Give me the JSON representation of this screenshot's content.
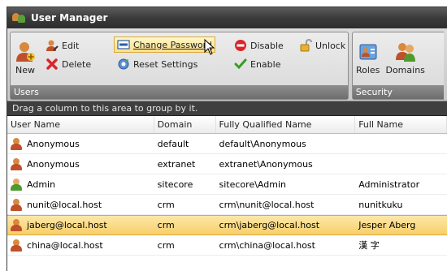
{
  "window": {
    "title": "User Manager"
  },
  "ribbon": {
    "users_group": {
      "label": "Users",
      "new_label": "New",
      "edit_label": "Edit",
      "delete_label": "Delete",
      "change_password_label": "Change Password",
      "reset_settings_label": "Reset Settings",
      "disable_label": "Disable",
      "enable_label": "Enable",
      "unlock_label": "Unlock"
    },
    "security_group": {
      "label": "Security",
      "roles_label": "Roles",
      "domains_label": "Domains"
    }
  },
  "grid": {
    "group_hint": "Drag a column to this area to group by it.",
    "columns": [
      "User Name",
      "Domain",
      "Fully Qualified Name",
      "Full Name"
    ],
    "rows": [
      {
        "user_name": "Anonymous",
        "domain": "default",
        "fqn": "default\\Anonymous",
        "full_name": "",
        "icon_color": "#c0502a"
      },
      {
        "user_name": "Anonymous",
        "domain": "extranet",
        "fqn": "extranet\\Anonymous",
        "full_name": "",
        "icon_color": "#c0502a"
      },
      {
        "user_name": "Admin",
        "domain": "sitecore",
        "fqn": "sitecore\\Admin",
        "full_name": "Administrator",
        "icon_color": "#4f9a2e"
      },
      {
        "user_name": "nunit@local.host",
        "domain": "crm",
        "fqn": "crm\\nunit@local.host",
        "full_name": "nunitkuku",
        "icon_color": "#c0502a"
      },
      {
        "user_name": "jaberg@local.host",
        "domain": "crm",
        "fqn": "crm\\jaberg@local.host",
        "full_name": "Jesper Aberg",
        "icon_color": "#c0502a",
        "selected": true
      },
      {
        "user_name": "china@local.host",
        "domain": "crm",
        "fqn": "crm\\china@local.host",
        "full_name": "漢 字",
        "icon_color": "#c0502a"
      }
    ]
  },
  "colors": {
    "selection": "#f7cf6a",
    "title_bar": "#3b3b3b",
    "group_bar": "#3f3f3f"
  }
}
